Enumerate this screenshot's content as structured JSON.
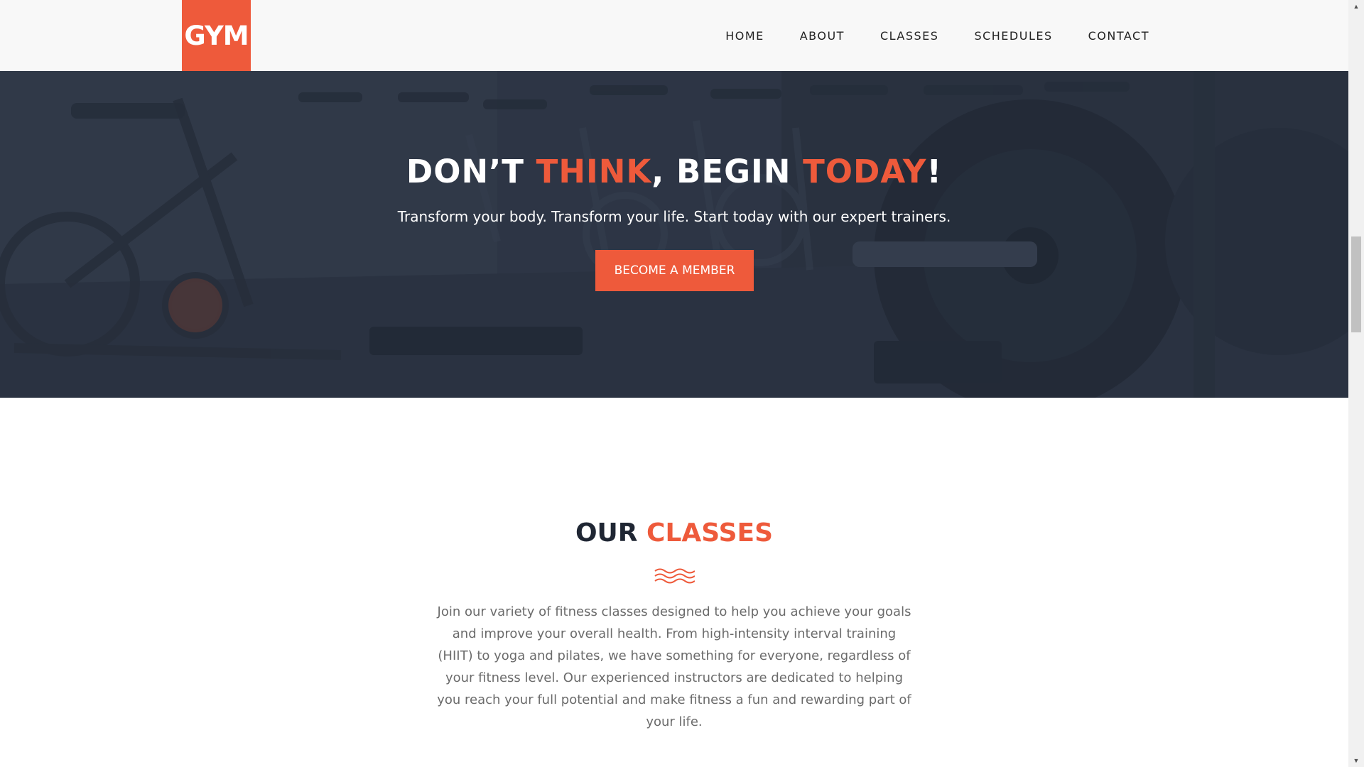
{
  "header": {
    "logo_text": "GYM",
    "nav": [
      "HOME",
      "ABOUT",
      "CLASSES",
      "SCHEDULES",
      "CONTACT"
    ]
  },
  "hero": {
    "title_part1": "DON’T ",
    "title_accent1": "THINK",
    "title_part2": ", BEGIN ",
    "title_accent2": "TODAY",
    "title_part3": "!",
    "subtitle": "Transform your body. Transform your life. Start today with our expert trainers.",
    "button_label": "BECOME A MEMBER"
  },
  "classes": {
    "title_part1": "OUR ",
    "title_accent": "CLASSES",
    "description": "Join our variety of fitness classes designed to help you achieve your goals and improve your overall health. From high-intensity interval training (HIIT) to yoga and pilates, we have something for everyone, regardless of your fitness level. Our experienced instructors are dedicated to helping you reach your full potential and make fitness a fun and rewarding part of your life."
  },
  "colors": {
    "accent": "#ee5a3b",
    "dark": "#1f2633",
    "hero_overlay": "#2c3544"
  },
  "icons": {
    "wave": "wave-divider-icon",
    "scroll_up": "scroll-up-arrow-icon",
    "scroll_down": "scroll-down-arrow-icon"
  }
}
